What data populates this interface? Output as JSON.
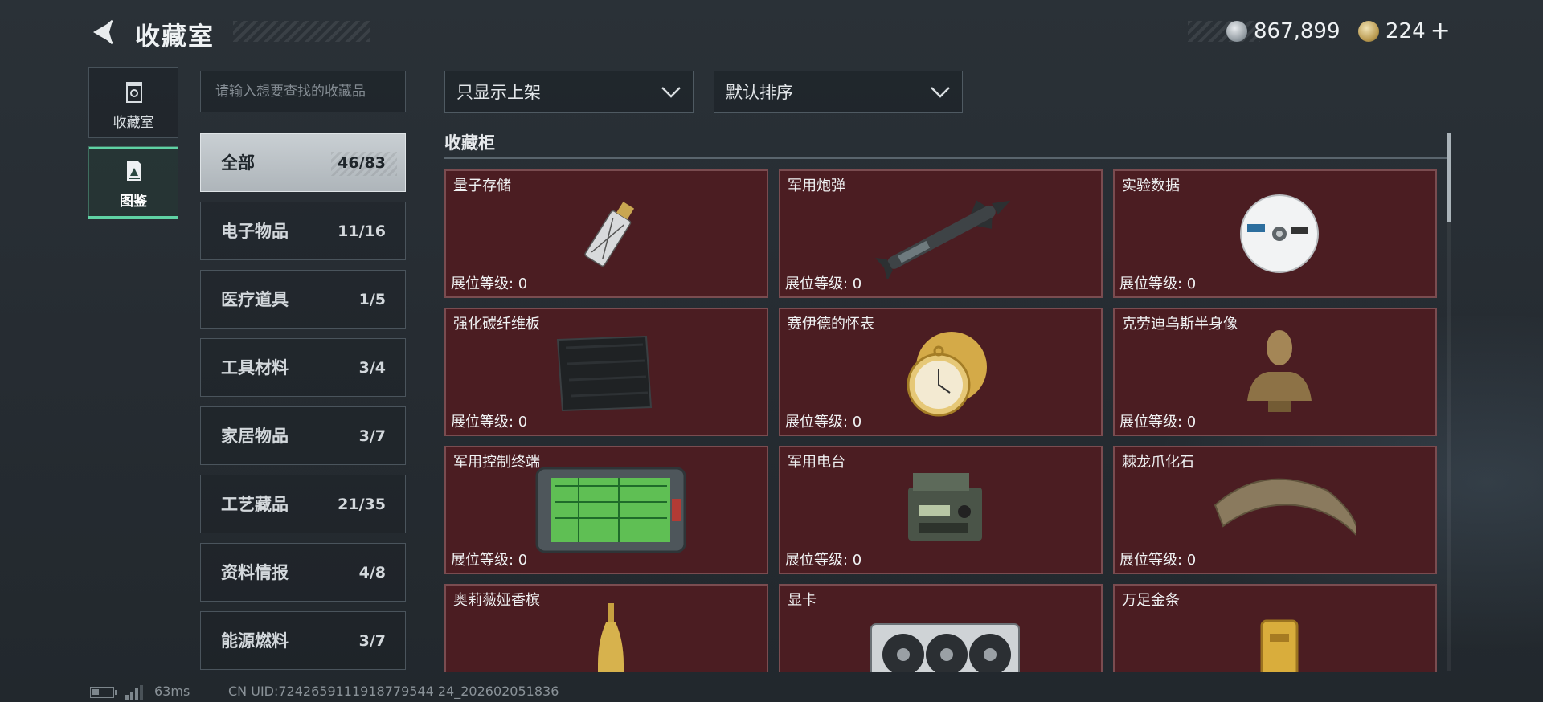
{
  "header": {
    "title": "收藏室",
    "currency_silver": "867,899",
    "currency_gold": "224",
    "plus": "+"
  },
  "nav": [
    {
      "label": "收藏室",
      "icon": "collection-room-icon",
      "active": false
    },
    {
      "label": "图鉴",
      "icon": "codex-icon",
      "active": true
    }
  ],
  "search": {
    "placeholder": "请输入想要查找的收藏品"
  },
  "categories": [
    {
      "name": "全部",
      "count": "46/83",
      "active": true
    },
    {
      "name": "电子物品",
      "count": "11/16"
    },
    {
      "name": "医疗道具",
      "count": "1/5"
    },
    {
      "name": "工具材料",
      "count": "3/4"
    },
    {
      "name": "家居物品",
      "count": "3/7"
    },
    {
      "name": "工艺藏品",
      "count": "21/35"
    },
    {
      "name": "资料情报",
      "count": "4/8"
    },
    {
      "name": "能源燃料",
      "count": "3/7"
    }
  ],
  "filters": {
    "shelf_filter": "只显示上架",
    "sort": "默认排序"
  },
  "section": {
    "title": "收藏柜"
  },
  "items": [
    {
      "name": "量子存储",
      "level_label": "展位等级: 0",
      "icon": "usb-drive-icon"
    },
    {
      "name": "军用炮弹",
      "level_label": "展位等级: 0",
      "icon": "missile-icon"
    },
    {
      "name": "实验数据",
      "level_label": "展位等级: 0",
      "icon": "disc-icon"
    },
    {
      "name": "强化碳纤维板",
      "level_label": "展位等级: 0",
      "icon": "carbon-plate-icon"
    },
    {
      "name": "赛伊德的怀表",
      "level_label": "展位等级: 0",
      "icon": "pocket-watch-icon"
    },
    {
      "name": "克劳迪乌斯半身像",
      "level_label": "展位等级: 0",
      "icon": "bust-statue-icon"
    },
    {
      "name": "军用控制终端",
      "level_label": "展位等级: 0",
      "icon": "control-terminal-icon"
    },
    {
      "name": "军用电台",
      "level_label": "展位等级: 0",
      "icon": "military-radio-icon"
    },
    {
      "name": "棘龙爪化石",
      "level_label": "展位等级: 0",
      "icon": "claw-fossil-icon"
    },
    {
      "name": "奥莉薇娅香槟",
      "level_label": "",
      "icon": "champagne-bottle-icon"
    },
    {
      "name": "显卡",
      "level_label": "",
      "icon": "graphics-card-icon"
    },
    {
      "name": "万足金条",
      "level_label": "",
      "icon": "gold-bar-icon"
    }
  ],
  "status": {
    "ping": "63ms",
    "uid": "CN UID:7242659111918779544 24_202602051836"
  },
  "colors": {
    "card_bg": "#4b1d22",
    "card_border": "#7a4c50",
    "accent": "#5fd2a4",
    "page_bg": "#262c32"
  }
}
